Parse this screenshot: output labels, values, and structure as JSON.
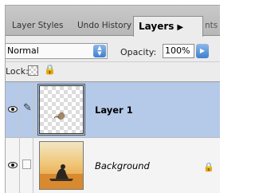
{
  "tabs": [
    {
      "label": "Layer Styles",
      "active": false
    },
    {
      "label": "Undo History",
      "active": false
    },
    {
      "label": "Layers",
      "active": true
    },
    {
      "label": "nts",
      "active": false
    }
  ],
  "tab_menu_icon": "triangle-right-icon",
  "blend_mode": "Normal",
  "opacity_label": "Opacity:",
  "opacity_value": "100%",
  "lock_label": "Lock:",
  "layers": [
    {
      "name": "Layer 1",
      "selected": true,
      "visible": true,
      "brush_active": true
    },
    {
      "name": "Background",
      "selected": false,
      "visible": true,
      "locked": true
    }
  ],
  "colors": {
    "selected_row": "#b5c9e8",
    "accent_blue": "#3f7fd0",
    "panel_bg": "#ececec"
  }
}
